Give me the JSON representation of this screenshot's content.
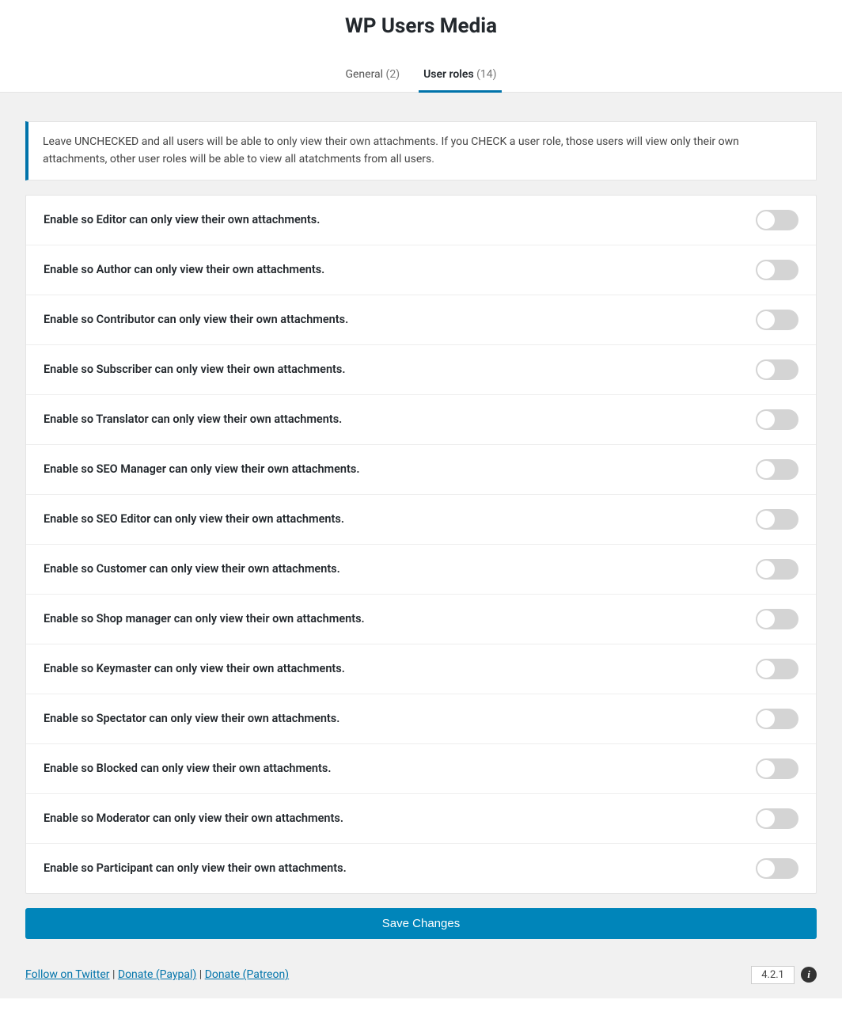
{
  "title": "WP Users Media",
  "tabs": [
    {
      "label": "General",
      "count": "(2)",
      "active": false
    },
    {
      "label": "User roles",
      "count": "(14)",
      "active": true
    }
  ],
  "notice": "Leave UNCHECKED and all users will be able to only view their own attachments. If you CHECK a user role, those users will view only their own attachments, other user roles will be able to view all atatchments from all users.",
  "settings": [
    {
      "label": "Enable so Editor can only view their own attachments.",
      "on": false
    },
    {
      "label": "Enable so Author can only view their own attachments.",
      "on": false
    },
    {
      "label": "Enable so Contributor can only view their own attachments.",
      "on": false
    },
    {
      "label": "Enable so Subscriber can only view their own attachments.",
      "on": false
    },
    {
      "label": "Enable so Translator can only view their own attachments.",
      "on": false
    },
    {
      "label": "Enable so SEO Manager can only view their own attachments.",
      "on": false
    },
    {
      "label": "Enable so SEO Editor can only view their own attachments.",
      "on": false
    },
    {
      "label": "Enable so Customer can only view their own attachments.",
      "on": false
    },
    {
      "label": "Enable so Shop manager can only view their own attachments.",
      "on": false
    },
    {
      "label": "Enable so Keymaster can only view their own attachments.",
      "on": false
    },
    {
      "label": "Enable so Spectator can only view their own attachments.",
      "on": false
    },
    {
      "label": "Enable so Blocked can only view their own attachments.",
      "on": false
    },
    {
      "label": "Enable so Moderator can only view their own attachments.",
      "on": false
    },
    {
      "label": "Enable so Participant can only view their own attachments.",
      "on": false
    }
  ],
  "save_label": "Save Changes",
  "footer": {
    "twitter": "Follow on Twitter",
    "paypal": "Donate (Paypal)",
    "patreon": "Donate (Patreon)",
    "sep": " | ",
    "version": "4.2.1",
    "info_glyph": "i"
  }
}
